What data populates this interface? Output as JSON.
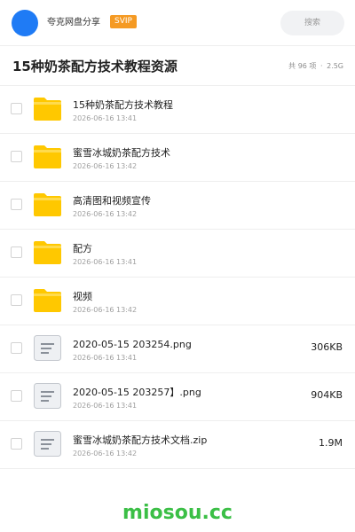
{
  "header": {
    "username": "夸克网盘分享",
    "badge": "SVIP",
    "search_label": "搜索"
  },
  "folder": {
    "title": "15种奶茶配方技术教程资源",
    "count": "共 96 项",
    "separator": "·",
    "size": "2.5G"
  },
  "files": [
    {
      "name": "15种奶茶配方技术教程",
      "date": "2026-06-16 13:41",
      "size": "",
      "icon": "folder-icon"
    },
    {
      "name": "蜜雪冰城奶茶配方技术",
      "date": "2026-06-16 13:42",
      "size": "",
      "icon": "folder-icon"
    },
    {
      "name": "高清图和视频宣传",
      "date": "2026-06-16 13:42",
      "size": "",
      "icon": "folder-icon"
    },
    {
      "name": "配方",
      "date": "2026-06-16 13:41",
      "size": "",
      "icon": "folder-icon"
    },
    {
      "name": "视频",
      "date": "2026-06-16 13:42",
      "size": "",
      "icon": "folder-icon"
    },
    {
      "name": "2020-05-15 203254.png",
      "date": "2026-06-16 13:41",
      "size": "306KB",
      "icon": "file-icon"
    },
    {
      "name": "2020-05-15 203257】.png",
      "date": "2026-06-16 13:41",
      "size": "904KB",
      "icon": "file-icon"
    },
    {
      "name": "蜜雪冰城奶茶配方技术文档.zip",
      "date": "2026-06-16 13:42",
      "size": "1.9M",
      "icon": "file-icon"
    }
  ],
  "watermark": "miosou.cc",
  "colors": {
    "accent_blue": "#1f7bf5",
    "svip_orange": "#f59a23",
    "folder_yellow": "#ffc800",
    "watermark_green": "#3bbf46"
  }
}
